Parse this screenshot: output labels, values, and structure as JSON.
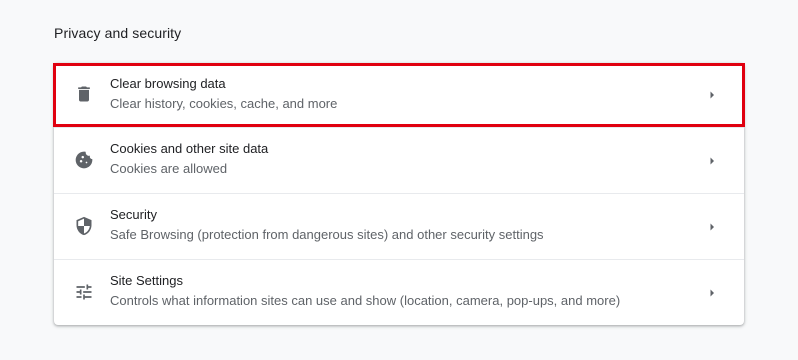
{
  "section": {
    "title": "Privacy and security"
  },
  "items": [
    {
      "title": "Clear browsing data",
      "subtitle": "Clear history, cookies, cache, and more",
      "icon": "trash-icon",
      "highlighted": true
    },
    {
      "title": "Cookies and other site data",
      "subtitle": "Cookies are allowed",
      "icon": "cookie-icon",
      "highlighted": false
    },
    {
      "title": "Security",
      "subtitle": "Safe Browsing (protection from dangerous sites) and other security settings",
      "icon": "shield-icon",
      "highlighted": false
    },
    {
      "title": "Site Settings",
      "subtitle": "Controls what information sites can use and show (location, camera, pop-ups, and more)",
      "icon": "tune-icon",
      "highlighted": false
    }
  ],
  "colors": {
    "background": "#f8f9fa",
    "card": "#ffffff",
    "text_primary": "#202124",
    "text_secondary": "#5f6368",
    "icon": "#5f6368",
    "highlight_border": "#e0000f"
  }
}
